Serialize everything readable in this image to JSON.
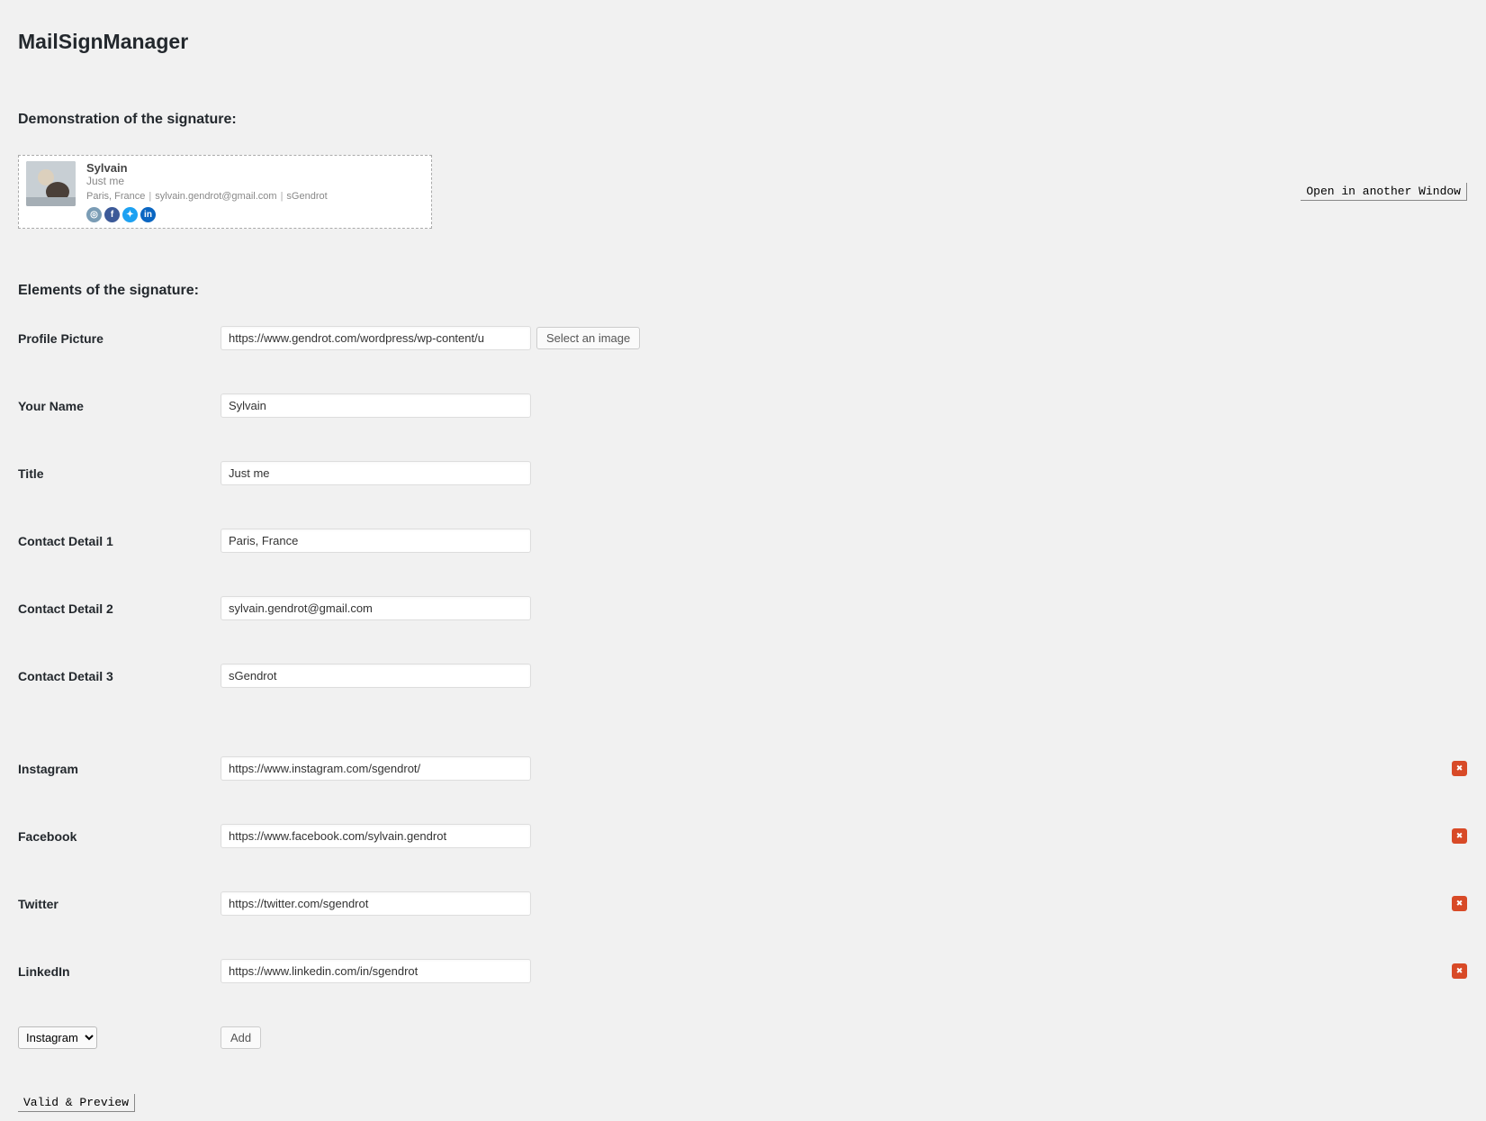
{
  "app_title": "MailSignManager",
  "section_demo_title": "Demonstration of the signature:",
  "section_elements_title": "Elements of the signature:",
  "open_window_label": "Open in another Window",
  "signature": {
    "name": "Sylvain",
    "title": "Just me",
    "contact1": "Paris, France",
    "contact2": "sylvain.gendrot@gmail.com",
    "contact3": "sGendrot"
  },
  "fields": {
    "profile_picture": {
      "label": "Profile Picture",
      "value": "https://www.gendrot.com/wordpress/wp-content/u",
      "select_btn": "Select an image"
    },
    "your_name": {
      "label": "Your Name",
      "value": "Sylvain"
    },
    "title": {
      "label": "Title",
      "value": "Just me"
    },
    "contact1": {
      "label": "Contact Detail 1",
      "value": "Paris, France"
    },
    "contact2": {
      "label": "Contact Detail 2",
      "value": "sylvain.gendrot@gmail.com"
    },
    "contact3": {
      "label": "Contact Detail 3",
      "value": "sGendrot"
    }
  },
  "socials": [
    {
      "label": "Instagram",
      "value": "https://www.instagram.com/sgendrot/"
    },
    {
      "label": "Facebook",
      "value": "https://www.facebook.com/sylvain.gendrot"
    },
    {
      "label": "Twitter",
      "value": "https://twitter.com/sgendrot"
    },
    {
      "label": "LinkedIn",
      "value": "https://www.linkedin.com/in/sgendrot"
    }
  ],
  "add_social": {
    "selected": "Instagram",
    "btn": "Add"
  },
  "submit_label": "Valid & Preview"
}
